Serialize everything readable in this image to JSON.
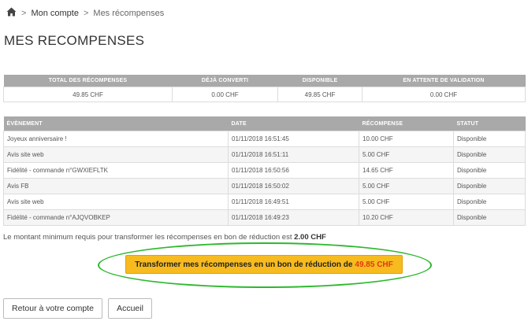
{
  "breadcrumb": {
    "home_icon": "home-icon",
    "separator": ">",
    "account": "Mon compte",
    "current": "Mes récompenses"
  },
  "page_title": "MES RECOMPENSES",
  "summary": {
    "headers": [
      "TOTAL DES RÉCOMPENSES",
      "DÉJÀ CONVERTI",
      "DISPONIBLE",
      "EN ATTENTE DE VALIDATION"
    ],
    "values": [
      "49.85 CHF",
      "0.00 CHF",
      "49.85 CHF",
      "0.00 CHF"
    ]
  },
  "events": {
    "headers": [
      "ÉVÈNEMENT",
      "DATE",
      "RÉCOMPENSE",
      "STATUT"
    ],
    "rows": [
      {
        "event": "Joyeux anniversaire !",
        "date": "01/11/2018 16:51:45",
        "reward": "10.00 CHF",
        "status": "Disponible"
      },
      {
        "event": "Avis site web",
        "date": "01/11/2018 16:51:11",
        "reward": "5.00 CHF",
        "status": "Disponible"
      },
      {
        "event": "Fidélité - commande n°GWXIEFLTK",
        "date": "01/11/2018 16:50:56",
        "reward": "14.65 CHF",
        "status": "Disponible"
      },
      {
        "event": "Avis FB",
        "date": "01/11/2018 16:50:02",
        "reward": "5.00 CHF",
        "status": "Disponible"
      },
      {
        "event": "Avis site web",
        "date": "01/11/2018 16:49:51",
        "reward": "5.00 CHF",
        "status": "Disponible"
      },
      {
        "event": "Fidélité - commande n°AJQVOBKEP",
        "date": "01/11/2018 16:49:23",
        "reward": "10.20 CHF",
        "status": "Disponible"
      }
    ]
  },
  "min_note": {
    "text": "Le montant minimum requis pour transformer les récompenses en bon de réduction est",
    "amount": "2.00 CHF"
  },
  "transform_button": {
    "label": "Transformer mes récompenses en un bon de réduction de",
    "amount": "49.85 CHF"
  },
  "buttons": {
    "back": "Retour à votre compte",
    "home": "Accueil"
  },
  "colors": {
    "header_bg": "#a9a9a9",
    "button_bg": "#f7bb1f",
    "amount_red": "#e03a0f",
    "ellipse_green": "#2db82d"
  }
}
